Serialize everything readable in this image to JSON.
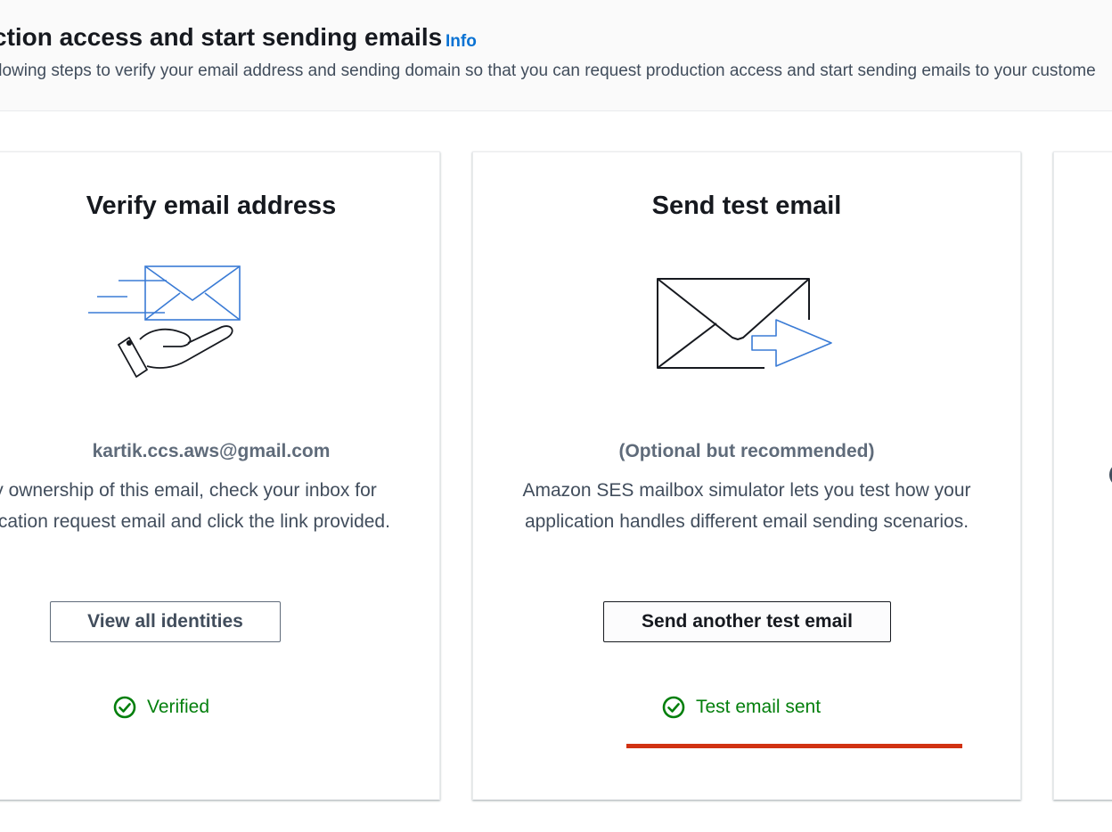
{
  "header": {
    "title": "ction access and start sending emails",
    "info_link": "Info",
    "description": "llowing steps to verify your email address and sending domain so that you can request production access and start sending emails to your custome"
  },
  "cards": [
    {
      "title": "Verify email address",
      "illustration_icon": "envelope-hand-icon",
      "subtitle": "kartik.ccs.aws@gmail.com",
      "body_lines": [
        "Verify ownership of this email, check your inbox for",
        "a verification request email and click the link provided."
      ],
      "button_label": "View all identities",
      "status_icon": "check-circle-icon",
      "status_text": "Verified"
    },
    {
      "title": "Send test email",
      "illustration_icon": "envelope-arrow-icon",
      "subtitle": "(Optional but recommended)",
      "body_lines": [
        "Amazon SES mailbox simulator lets you test how your",
        "application handles different email sending scenarios."
      ],
      "button_label": "Send another test email",
      "status_icon": "check-circle-icon",
      "status_text": "Test email sent"
    }
  ],
  "colors": {
    "success": "#037f0c",
    "link": "#0972d3",
    "highlight": "#d13212",
    "icon_blue": "#3a7bd5"
  }
}
